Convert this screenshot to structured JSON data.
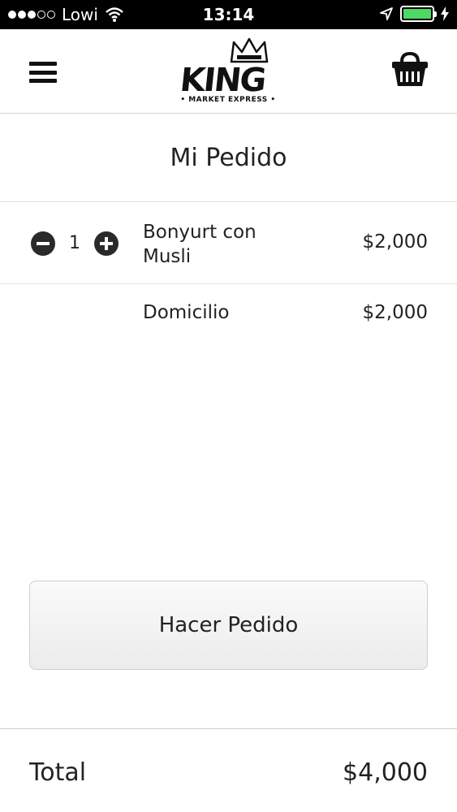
{
  "status_bar": {
    "carrier": "Lowi",
    "time": "13:14",
    "signal_dots_filled": 3,
    "signal_dots_total": 5,
    "battery_level": 1.0,
    "battery_color": "#4cd964"
  },
  "header": {
    "menu_icon": "hamburger-menu-icon",
    "logo_text": "KING",
    "logo_subtext": "• MARKET EXPRESS •",
    "cart_icon": "basket-icon"
  },
  "page_title": "Mi Pedido",
  "order_items": [
    {
      "quantity": "1",
      "name": "Bonyurt con Musli",
      "price": "$2,000"
    }
  ],
  "delivery": {
    "label": "Domicilio",
    "price": "$2,000"
  },
  "actions": {
    "place_order_label": "Hacer Pedido"
  },
  "total": {
    "label": "Total",
    "value": "$4,000"
  }
}
